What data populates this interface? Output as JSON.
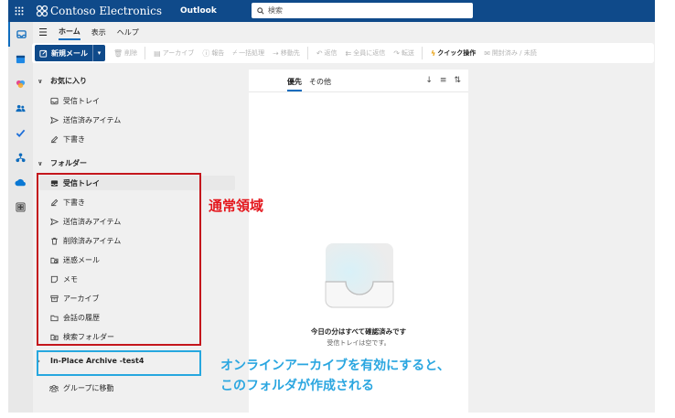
{
  "topbar": {
    "brand": "Contoso Electronics",
    "app_name": "Outlook",
    "search_placeholder": "検索"
  },
  "ribbon_tabs": [
    {
      "label": "ホーム",
      "active": true
    },
    {
      "label": "表示",
      "active": false
    },
    {
      "label": "ヘルプ",
      "active": false
    }
  ],
  "ribbon": {
    "new_mail": "新規メール",
    "delete": "削除",
    "archive": "アーカイブ",
    "report": "報告",
    "sweep": "一括処理",
    "move_to": "移動先",
    "reply": "返信",
    "reply_all": "全員に返信",
    "forward": "転送",
    "quick_steps": "クイック操作",
    "read_unread": "開封済み / 未読"
  },
  "folders": {
    "favorites_header": "お気に入り",
    "favorites": [
      {
        "label": "受信トレイ",
        "icon": "inbox-icon"
      },
      {
        "label": "送信済みアイテム",
        "icon": "send-icon"
      },
      {
        "label": "下書き",
        "icon": "draft-icon"
      }
    ],
    "folders_header": "フォルダー",
    "items": [
      {
        "label": "受信トレイ",
        "icon": "inbox-icon",
        "selected": true
      },
      {
        "label": "下書き",
        "icon": "draft-icon"
      },
      {
        "label": "送信済みアイテム",
        "icon": "send-icon"
      },
      {
        "label": "削除済みアイテム",
        "icon": "trash-icon"
      },
      {
        "label": "迷惑メール",
        "icon": "junk-icon"
      },
      {
        "label": "メモ",
        "icon": "note-icon"
      },
      {
        "label": "アーカイブ",
        "icon": "archive-icon"
      },
      {
        "label": "会話の履歴",
        "icon": "folder-icon"
      },
      {
        "label": "検索フォルダー",
        "icon": "search-folder-icon"
      }
    ],
    "archive_header": "In-Place Archive -test4",
    "go_to_groups": "グループに移動"
  },
  "message_list": {
    "tab_focused": "優先",
    "tab_other": "その他",
    "empty_title": "今日の分はすべて確認済みです",
    "empty_subtitle": "受信トレイは空です。"
  },
  "annotations": {
    "normal_area": "通常領域",
    "archive_note_line1": "オンラインアーカイブを有効にすると、",
    "archive_note_line2": "このフォルダが作成される"
  },
  "colors": {
    "topbar": "#0f4a8a",
    "accent": "#0f6cbd",
    "annotation_red": "#e4161c",
    "annotation_blue": "#2aa6e0"
  }
}
